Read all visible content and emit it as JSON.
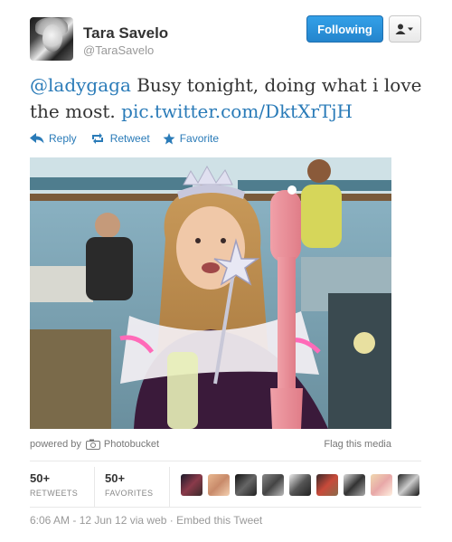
{
  "user": {
    "display_name": "Tara Savelo",
    "handle": "@TaraSavelo"
  },
  "follow_button_label": "Following",
  "tweet": {
    "mention": "@ladygaga",
    "text": " Busy tonight, doing what i love the most. ",
    "link": "pic.twitter.com/DktXrTjH"
  },
  "actions": {
    "reply": "Reply",
    "retweet": "Retweet",
    "favorite": "Favorite"
  },
  "media": {
    "powered_by": "powered by",
    "provider": "Photobucket",
    "flag": "Flag this media"
  },
  "stats": {
    "retweets_count": "50+",
    "retweets_label": "RETWEETS",
    "favorites_count": "50+",
    "favorites_label": "FAVORITES"
  },
  "favoriters_count": 9,
  "timestamp": "6:06 AM - 12 Jun 12 via web · Embed this Tweet",
  "colors": {
    "link": "#2a7bb8",
    "follow_button": "#2485cd"
  },
  "icons": [
    "user-dropdown-icon",
    "reply-icon",
    "retweet-icon",
    "favorite-star-icon",
    "camera-icon"
  ]
}
